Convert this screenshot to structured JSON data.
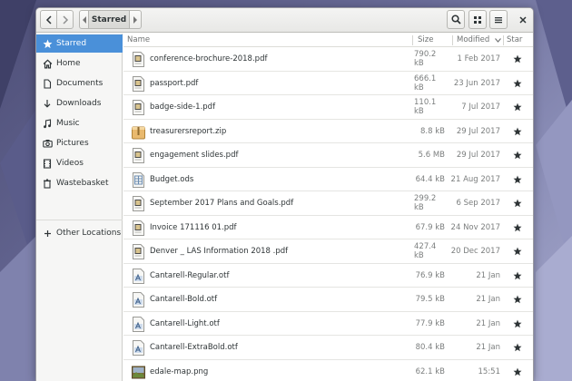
{
  "headerbar": {
    "path_current": "Starred"
  },
  "sidebar": {
    "items": [
      {
        "label": "Starred",
        "icon": "star-icon",
        "active": true
      },
      {
        "label": "Home",
        "icon": "home-icon"
      },
      {
        "label": "Documents",
        "icon": "document-icon"
      },
      {
        "label": "Downloads",
        "icon": "download-icon"
      },
      {
        "label": "Music",
        "icon": "music-icon"
      },
      {
        "label": "Pictures",
        "icon": "camera-icon"
      },
      {
        "label": "Videos",
        "icon": "video-icon"
      },
      {
        "label": "Wastebasket",
        "icon": "trash-icon"
      }
    ],
    "other_locations": {
      "label": "Other Locations",
      "icon": "plus-icon"
    }
  },
  "columns": {
    "name": "Name",
    "size": "Size",
    "modified": "Modified",
    "star": "Star"
  },
  "files": [
    {
      "name": "conference-brochure-2018.pdf",
      "size": "790.2 kB",
      "modified": "1 Feb 2017",
      "type": "pdf"
    },
    {
      "name": "passport.pdf",
      "size": "666.1 kB",
      "modified": "23 Jun 2017",
      "type": "pdf"
    },
    {
      "name": "badge-side-1.pdf",
      "size": "110.1 kB",
      "modified": "7 Jul 2017",
      "type": "pdf"
    },
    {
      "name": "treasurersreport.zip",
      "size": "8.8 kB",
      "modified": "29 Jul 2017",
      "type": "zip"
    },
    {
      "name": "engagement slides.pdf",
      "size": "5.6 MB",
      "modified": "29 Jul 2017",
      "type": "pdf"
    },
    {
      "name": "Budget.ods",
      "size": "64.4 kB",
      "modified": "21 Aug 2017",
      "type": "ods"
    },
    {
      "name": "September 2017 Plans and Goals.pdf",
      "size": "299.2 kB",
      "modified": "6 Sep 2017",
      "type": "pdf"
    },
    {
      "name": "Invoice 171116  01.pdf",
      "size": "67.9 kB",
      "modified": "24 Nov 2017",
      "type": "pdf"
    },
    {
      "name": "Denver _ LAS Information 2018 .pdf",
      "size": "427.4 kB",
      "modified": "20 Dec 2017",
      "type": "pdf"
    },
    {
      "name": "Cantarell-Regular.otf",
      "size": "76.9 kB",
      "modified": "21 Jan",
      "type": "font"
    },
    {
      "name": "Cantarell-Bold.otf",
      "size": "79.5 kB",
      "modified": "21 Jan",
      "type": "font"
    },
    {
      "name": "Cantarell-Light.otf",
      "size": "77.9 kB",
      "modified": "21 Jan",
      "type": "font"
    },
    {
      "name": "Cantarell-ExtraBold.otf",
      "size": "80.4 kB",
      "modified": "21 Jan",
      "type": "font"
    },
    {
      "name": "edale-map.png",
      "size": "62.1 kB",
      "modified": "15:51",
      "type": "image"
    }
  ],
  "colors": {
    "accent": "#4a90d9",
    "text": "#2e3436",
    "muted": "#7b7e7e"
  }
}
